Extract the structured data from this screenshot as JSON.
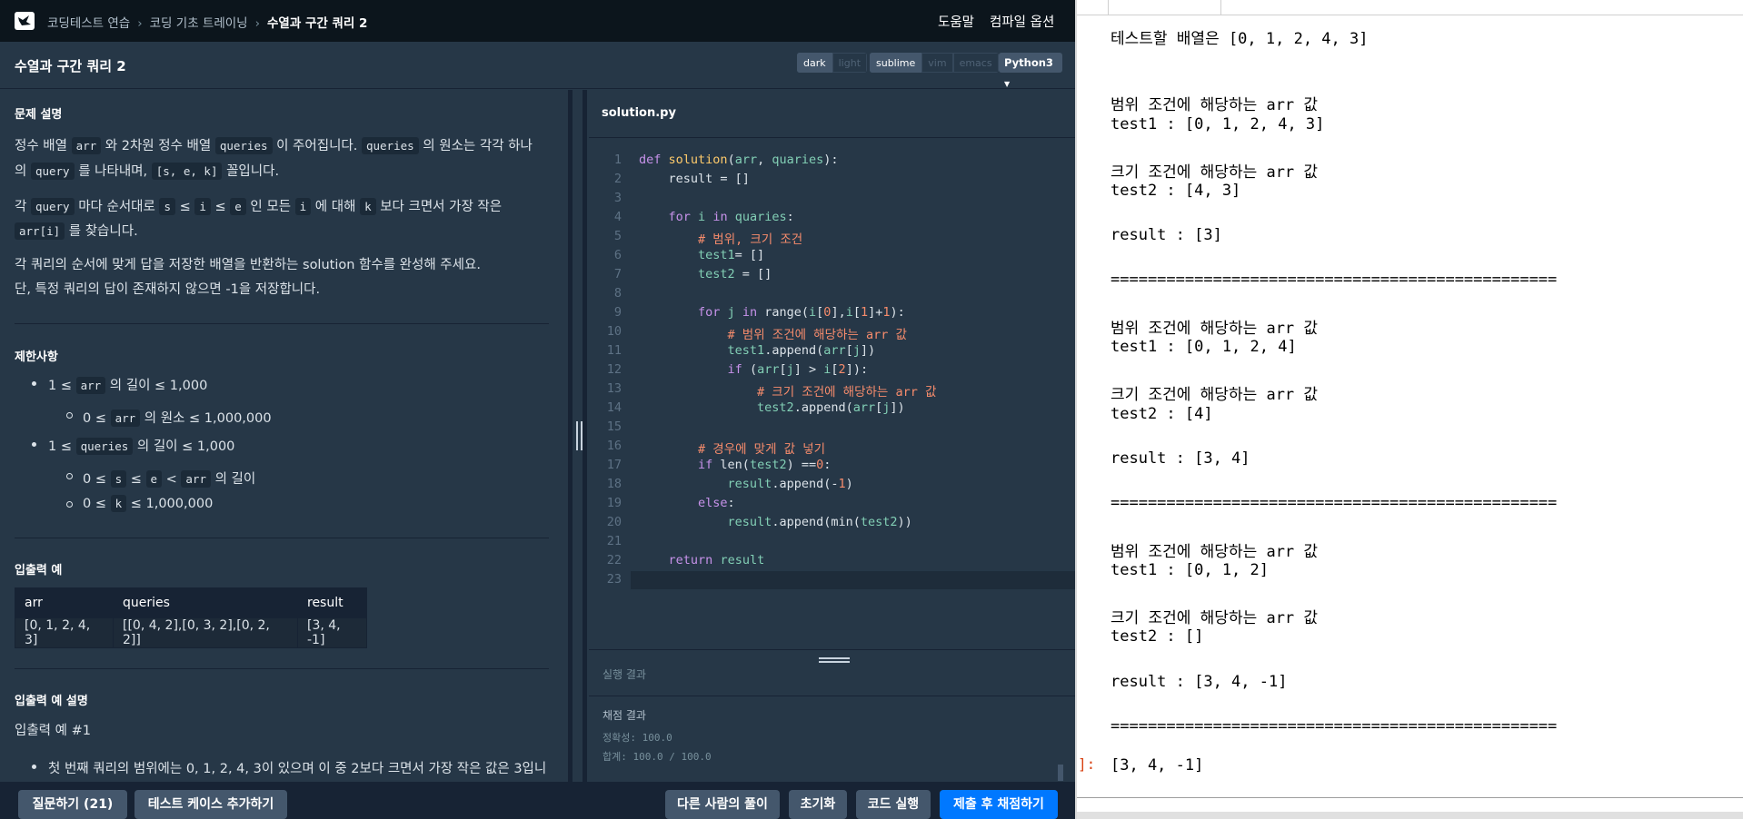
{
  "header": {
    "crumbs": [
      "코딩테스트 연습",
      "코딩 기초 트레이닝",
      "수열과 구간 쿼리 2"
    ],
    "help": "도움말",
    "compile_options": "컴파일 옵션"
  },
  "title": "수열과 구간 쿼리 2",
  "themes": {
    "dark": "dark",
    "light": "light"
  },
  "keymaps": {
    "sublime": "sublime",
    "vim": "vim",
    "emacs": "emacs"
  },
  "language": "Python3",
  "description": {
    "heading": "문제 설명",
    "p1a": "정수 배열 ",
    "p1b": "arr",
    "p1c": " 와 2차원 정수 배열 ",
    "p1d": "queries",
    "p1e": " 이 주어집니다. ",
    "p1f": "queries",
    "p1g": " 의 원소는 각각 하나",
    "p2a": "의 ",
    "p2b": "query",
    "p2c": " 를 나타내며, ",
    "p2d": "[s, e, k]",
    "p2e": " 꼴입니다.",
    "p3a": "각 ",
    "p3b": "query",
    "p3c": " 마다 순서대로 ",
    "p3d": "s",
    "p3e": " ≤ ",
    "p3f": "i",
    "p3g": " ≤ ",
    "p3h": "e",
    "p3i": " 인 모든 ",
    "p3j": "i",
    "p3k": " 에 대해 ",
    "p3l": "k",
    "p3m": " 보다 크면서 가장 작은",
    "p4a": "arr[i]",
    "p4b": " 를 찾습니다.",
    "p5": "각 쿼리의 순서에 맞게 답을 저장한 배열을 반환하는 solution 함수를 완성해 주세요.",
    "p6": "단, 특정 쿼리의 답이 존재하지 않으면 -1을 저장합니다."
  },
  "constraints": {
    "heading": "제한사항",
    "c1a": "1 ≤ ",
    "c1b": "arr",
    "c1c": " 의 길이 ≤ 1,000",
    "c2a": "0 ≤ ",
    "c2b": "arr",
    "c2c": " 의 원소 ≤ 1,000,000",
    "c3a": "1 ≤ ",
    "c3b": "queries",
    "c3c": " 의 길이 ≤ 1,000",
    "c4a": "0 ≤ ",
    "c4b": "s",
    "c4c": " ≤ ",
    "c4d": "e",
    "c4e": " < ",
    "c4f": "arr",
    "c4g": " 의 길이",
    "c5a": "0 ≤ ",
    "c5b": "k",
    "c5c": " ≤ 1,000,000"
  },
  "examples": {
    "heading": "입출력 예",
    "columns": [
      "arr",
      "queries",
      "result"
    ],
    "row": [
      "[0, 1, 2, 4, 3]",
      "[[0, 4, 2],[0, 3, 2],[0, 2, 2]]",
      "[3, 4, -1]"
    ]
  },
  "example_desc": {
    "heading": "입출력 예 설명",
    "sub": "입출력 예 #1",
    "item": "첫 번째 쿼리의 범위에는 0, 1, 2, 4, 3이 있으며 이 중 2보다 크면서 가장 작은 값은 3입니"
  },
  "editor": {
    "file": "solution.py",
    "line_numbers": [
      "1",
      "2",
      "3",
      "4",
      "5",
      "6",
      "7",
      "8",
      "9",
      "10",
      "11",
      "12",
      "13",
      "14",
      "15",
      "16",
      "17",
      "18",
      "19",
      "20",
      "21",
      "22",
      "23"
    ]
  },
  "results": {
    "run_label": "실행 결과",
    "grade_label": "채점 결과",
    "accuracy": "정확성: 100.0",
    "total": "합계: 100.0 / 100.0"
  },
  "buttons": {
    "ask": "질문하기 (21)",
    "add_test": "테스트 케이스 추가하기",
    "others": "다른 사람의 풀이",
    "reset": "초기화",
    "run": "코드 실행",
    "submit": "제출 후 채점하기"
  },
  "output": {
    "lines": [
      "테스트할 배열은 [0, 1, 2, 4, 3]",
      "범위 조건에 해당하는 arr 값",
      "test1 : [0, 1, 2, 4, 3]",
      "크기 조건에 해당하는 arr 값",
      "test2 : [4, 3]",
      "result : [3]",
      "================================================",
      "범위 조건에 해당하는 arr 값",
      "test1 : [0, 1, 2, 4]",
      "크기 조건에 해당하는 arr 값",
      "test2 : [4]",
      "result : [3, 4]",
      "================================================",
      "범위 조건에 해당하는 arr 값",
      "test1 : [0, 1, 2]",
      "크기 조건에 해당하는 arr 값",
      "test2 : []",
      "result : [3, 4, -1]",
      "================================================"
    ],
    "prompt": "]:",
    "final": "[3, 4, -1]"
  }
}
